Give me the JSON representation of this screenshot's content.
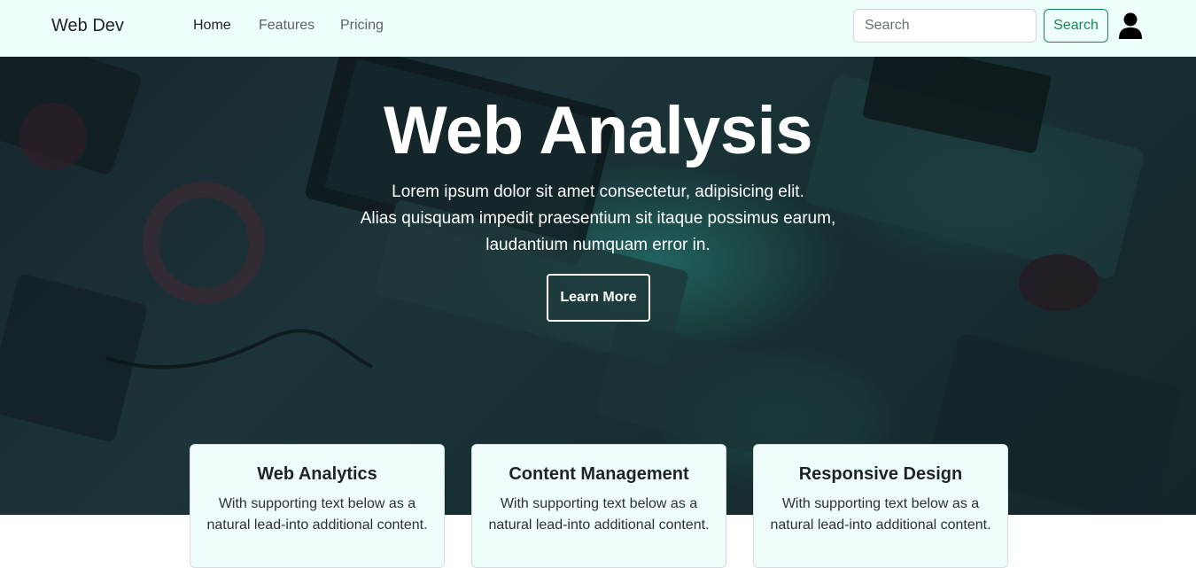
{
  "navbar": {
    "brand": "Web Dev",
    "links": [
      "Home",
      "Features",
      "Pricing"
    ],
    "search_placeholder": "Search",
    "search_button": "Search",
    "user_icon": "user-icon"
  },
  "hero": {
    "title": "Web Analysis",
    "lines": [
      "Lorem ipsum dolor sit amet consectetur, adipisicing elit.",
      "Alias quisquam impedit praesentium sit itaque possimus earum,",
      "laudantium numquam error in."
    ],
    "button": "Learn More"
  },
  "cards": [
    {
      "title": "Web Analytics",
      "text": "With supporting text below as a natural lead-into additional content."
    },
    {
      "title": "Content Management",
      "text": "With supporting text below as a natural lead-into additional content."
    },
    {
      "title": "Responsive Design",
      "text": "With supporting text below as a natural lead-into additional content."
    }
  ],
  "colors": {
    "navbar_bg": "#eefefd",
    "accent": "#198754",
    "card_bg": "#effefd"
  }
}
